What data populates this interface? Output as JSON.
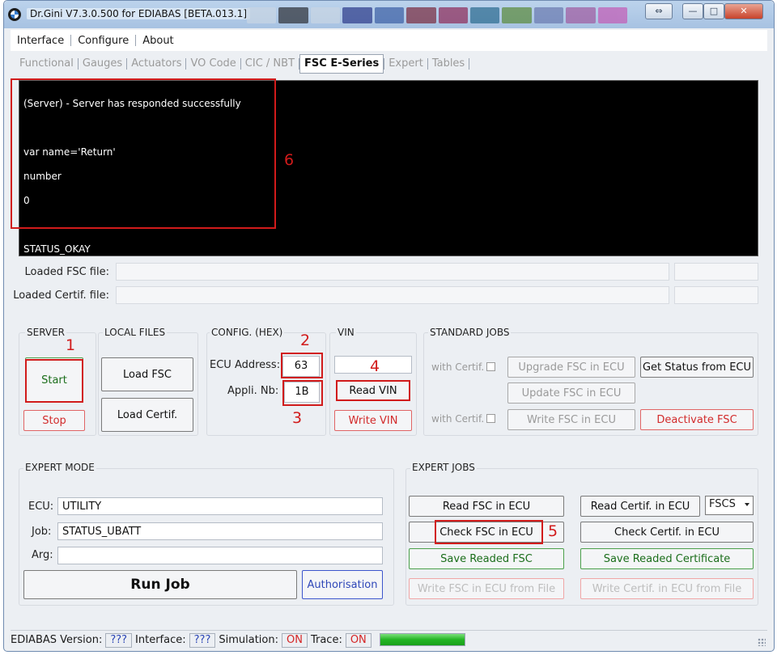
{
  "window": {
    "title": "Dr.Gini V7.3.0.500 for EDIABAS [BETA.013.1]",
    "accent": "#d11b1b"
  },
  "menu": [
    "Interface",
    "Configure",
    "About"
  ],
  "tabs": [
    {
      "label": "Functional"
    },
    {
      "label": "Gauges"
    },
    {
      "label": "Actuators"
    },
    {
      "label": "VO Code"
    },
    {
      "label": "CIC / NBT"
    },
    {
      "label": "FSC E-Series"
    },
    {
      "label": "Expert"
    },
    {
      "label": "Tables"
    }
  ],
  "console": {
    "lines": [
      "(Server) - Server has responded successfully",
      "",
      "var name='Return'",
      "number",
      "0",
      "",
      "STATUS_OKAY"
    ]
  },
  "files": {
    "fsc_label": "Loaded FSC file:",
    "certif_label": "Loaded Certif. file:"
  },
  "server": {
    "title": "SERVER",
    "start": "Start",
    "stop": "Stop"
  },
  "local_files": {
    "title": "LOCAL FILES",
    "load_fsc": "Load FSC",
    "load_certif": "Load Certif."
  },
  "config": {
    "title": "CONFIG. (HEX)",
    "ecu_label": "ECU Address:",
    "ecu_value": "63",
    "appli_label": "Appli. Nb:",
    "appli_value": "1B"
  },
  "vin": {
    "title": "VIN",
    "value": "",
    "read": "Read VIN",
    "write": "Write VIN"
  },
  "standard_jobs": {
    "title": "STANDARD JOBS",
    "with_certif_1": "with Certif.",
    "with_certif_2": "with Certif.",
    "upgrade": "Upgrade FSC in ECU",
    "update": "Update FSC in ECU",
    "write": "Write FSC in ECU",
    "get_status": "Get Status from ECU",
    "deactivate": "Deactivate FSC"
  },
  "expert_mode": {
    "title": "EXPERT MODE",
    "ecu_label": "ECU:",
    "ecu_value": "UTILITY",
    "job_label": "Job:",
    "job_value": "STATUS_UBATT",
    "arg_label": "Arg:",
    "arg_value": "",
    "run_job": "Run Job",
    "authorisation": "Authorisation"
  },
  "expert_jobs": {
    "title": "EXPERT JOBS",
    "read_fsc": "Read FSC in ECU",
    "check_fsc": "Check FSC in ECU",
    "save_fsc": "Save Readed FSC",
    "write_fsc_file": "Write FSC in ECU from File",
    "read_certif": "Read Certif. in ECU",
    "check_certif": "Check Certif. in ECU",
    "save_certif": "Save Readed Certificate",
    "write_certif_file": "Write Certif. in ECU from File",
    "combo_value": "FSCS"
  },
  "annotations": [
    "1",
    "2",
    "3",
    "4",
    "5",
    "6"
  ],
  "status": {
    "ediabas_label": "EDIABAS Version:",
    "ediabas_value": "???",
    "interface_label": "Interface:",
    "interface_value": "???",
    "simulation_label": "Simulation:",
    "simulation_value": "ON",
    "trace_label": "Trace:",
    "trace_value": "ON",
    "progress": 1.0
  }
}
